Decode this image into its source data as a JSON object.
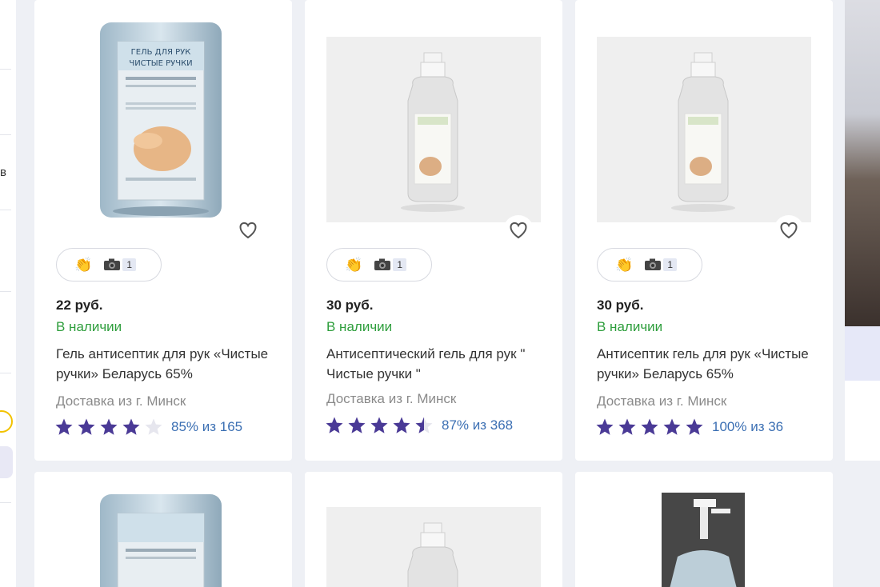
{
  "sidebar": {
    "fragment": "в"
  },
  "products": [
    {
      "price": "22 руб.",
      "stock": "В наличии",
      "title": "Гель антисептик для рук «Чистые ручки» Беларусь 65%",
      "delivery": "Доставка из г. Минск",
      "rating": 4.0,
      "rating_text": "85% из 165",
      "photo_count": "1",
      "label_text": "ГЕЛЬ ДЛЯ РУК ЧИСТЫЕ РУЧКИ"
    },
    {
      "price": "30 руб.",
      "stock": "В наличии",
      "title": "Антисептический гель для рук \" Чистые ручки \"",
      "delivery": "Доставка из г. Минск",
      "rating": 4.5,
      "rating_text": "87% из 368",
      "photo_count": "1"
    },
    {
      "price": "30 руб.",
      "stock": "В наличии",
      "title": "Антисептик гель для рук «Чистые ручки» Беларусь 65%",
      "delivery": "Доставка из г. Минск",
      "rating": 5.0,
      "rating_text": "100% из 36",
      "photo_count": "1"
    }
  ],
  "bottom_row": [
    {
      "image": "canister"
    },
    {
      "image": "bottle"
    },
    {
      "image": "pump-dispenser"
    }
  ],
  "colors": {
    "accent_star": "#4a3a96",
    "in_stock": "#2e9e3c",
    "rating_link": "#3b6fb3"
  },
  "icons": [
    "heart-icon",
    "clapping-hands-icon",
    "camera-icon",
    "star-icon"
  ]
}
